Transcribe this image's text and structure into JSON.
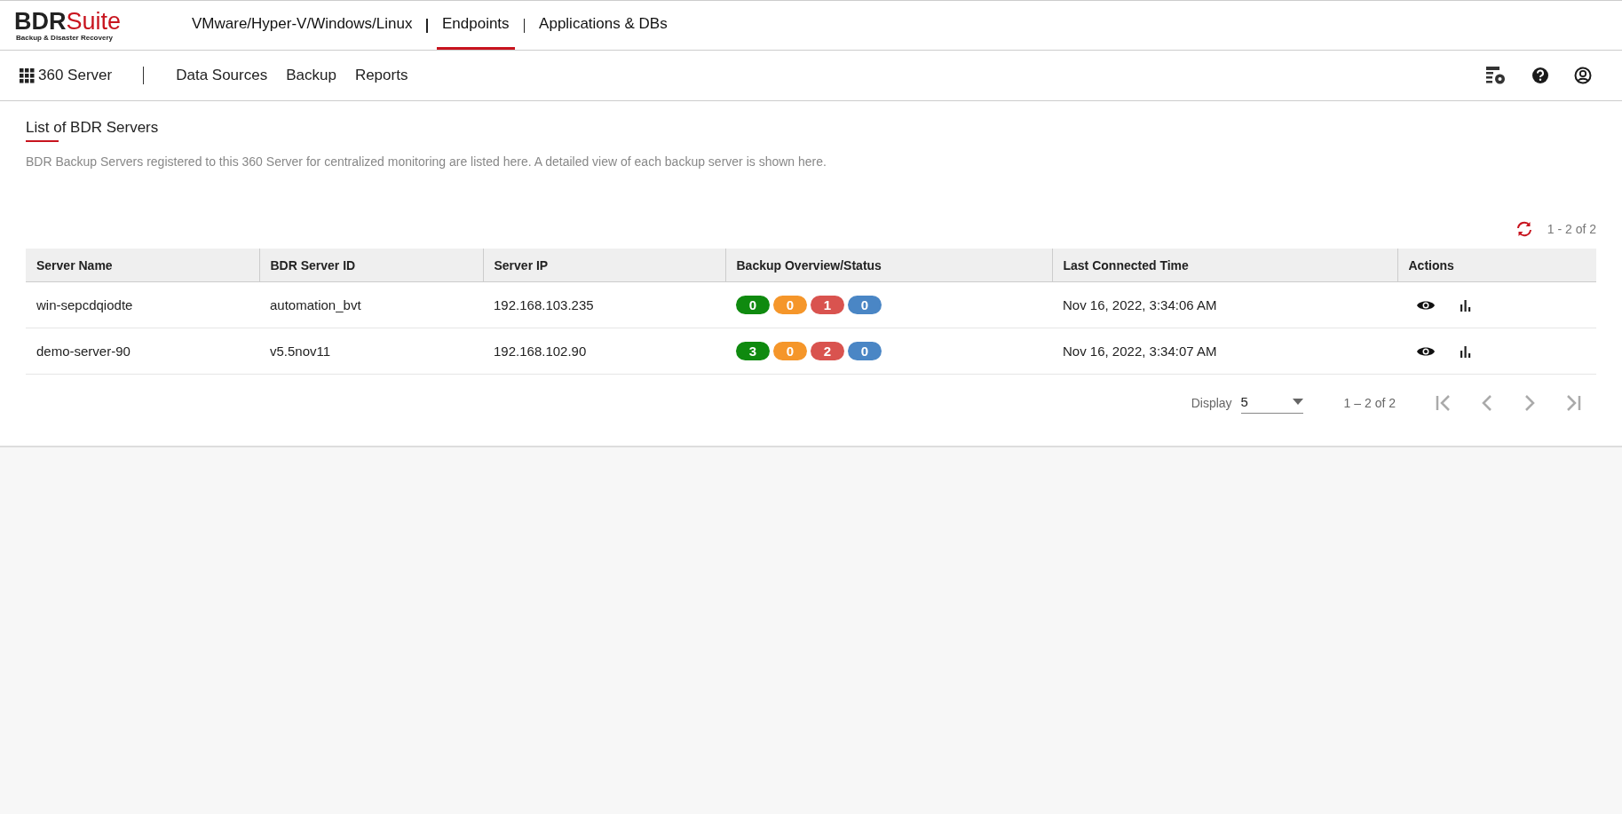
{
  "logo": {
    "part_1": "BDR",
    "part_2": "Suite",
    "tagline": "Backup & Disaster Recovery"
  },
  "top_nav": [
    {
      "label": "VMware/Hyper-V/Windows/Linux",
      "selected": false
    },
    {
      "label": "Endpoints",
      "selected": true
    },
    {
      "label": "Applications & DBs",
      "selected": false
    }
  ],
  "sub_nav": {
    "home": "360 Server",
    "items": [
      "Data Sources",
      "Backup",
      "Reports"
    ]
  },
  "page": {
    "title": "List of BDR Servers",
    "description": "BDR Backup Servers registered to this 360 Server for centralized monitoring are listed here. A detailed view of each backup server is shown here."
  },
  "range_top": "1 - 2 of 2",
  "table": {
    "columns": [
      "Server Name",
      "BDR Server ID",
      "Server IP",
      "Backup Overview/Status",
      "Last Connected Time",
      "Actions"
    ],
    "rows": [
      {
        "name": "win-sepcdqiodte",
        "id": "automation_bvt",
        "ip": "192.168.103.235",
        "badges": [
          {
            "value": "0",
            "color": "#0f8a0f"
          },
          {
            "value": "0",
            "color": "#f5962a"
          },
          {
            "value": "1",
            "color": "#d9534f"
          },
          {
            "value": "0",
            "color": "#4a86c5"
          }
        ],
        "time": "Nov 16, 2022, 3:34:06 AM"
      },
      {
        "name": "demo-server-90",
        "id": "v5.5nov11",
        "ip": "192.168.102.90",
        "badges": [
          {
            "value": "3",
            "color": "#0f8a0f"
          },
          {
            "value": "0",
            "color": "#f5962a"
          },
          {
            "value": "2",
            "color": "#d9534f"
          },
          {
            "value": "0",
            "color": "#4a86c5"
          }
        ],
        "time": "Nov 16, 2022, 3:34:07 AM"
      }
    ]
  },
  "pagination": {
    "display_label": "Display",
    "page_size": "5",
    "range": "1 – 2 of 2"
  }
}
